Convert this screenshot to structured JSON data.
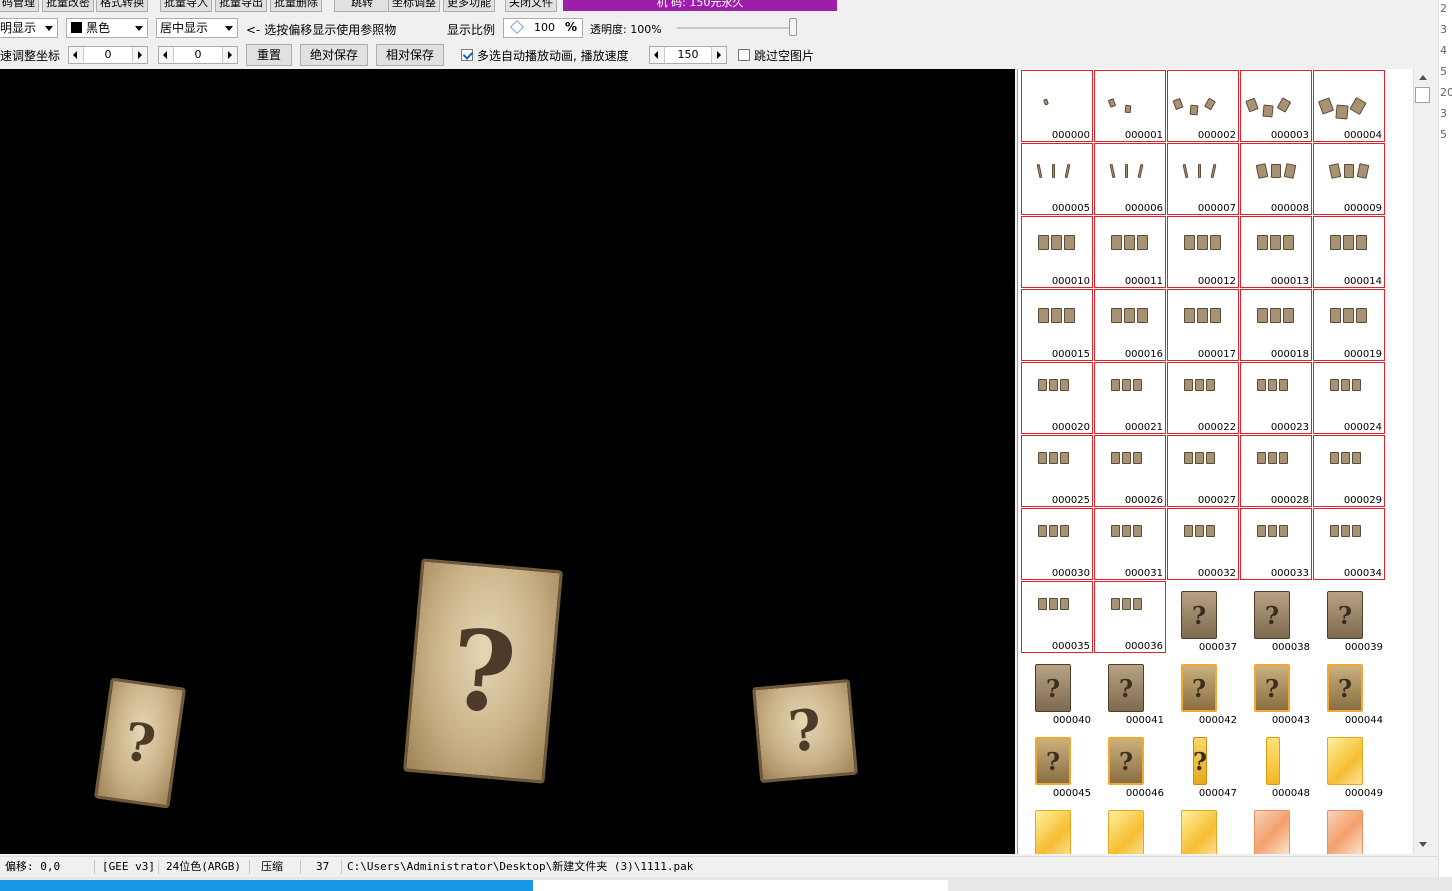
{
  "toolbar_top": {
    "buttons": [
      "码管理",
      "批量改密",
      "格式转换",
      "批量导入",
      "批量导出",
      "批量删除",
      "跳转",
      "坐标调整",
      "更多功能",
      "关闭文件"
    ],
    "banner": "机 码: 150元永久"
  },
  "toolbar1": {
    "display_mode": "明显示",
    "bg_color_label": "黑色",
    "bg_color_swatch": "#000000",
    "align": "居中显示",
    "hint": "<- 选按偏移显示使用参照物",
    "scale_label": "显示比例",
    "scale_value": "100",
    "scale_unit": "%",
    "opacity_label": "透明度: 100%",
    "opacity_value": 100
  },
  "toolbar2": {
    "adjust_label": "速调整坐标",
    "x_value": "0",
    "y_value": "0",
    "reset_button": "重置",
    "abs_save_button": "绝对保存",
    "rel_save_button": "相对保存",
    "autoplay_label": "多选自动播放动画, 播放速度",
    "autoplay_checked": true,
    "speed_value": "150",
    "skip_empty_label": "跳过空图片",
    "skip_empty_checked": false
  },
  "canvas": {
    "background": "#000000",
    "glyph": "?"
  },
  "thumbnails": {
    "items": [
      "000000",
      "000001",
      "000002",
      "000003",
      "000004",
      "000005",
      "000006",
      "000007",
      "000008",
      "000009",
      "000010",
      "000011",
      "000012",
      "000013",
      "000014",
      "000015",
      "000016",
      "000017",
      "000018",
      "000019",
      "000020",
      "000021",
      "000022",
      "000023",
      "000024",
      "000025",
      "000026",
      "000027",
      "000028",
      "000029",
      "000030",
      "000031",
      "000032",
      "000033",
      "000034",
      "000035",
      "000036",
      "000037",
      "000038",
      "000039",
      "000040",
      "000041",
      "000042",
      "000043",
      "000044",
      "000045",
      "000046",
      "000047",
      "000048",
      "000049",
      "",
      "",
      "",
      "",
      ""
    ],
    "selected_count": 37,
    "accent": "#e0202a"
  },
  "status": {
    "offset": "偏移: 0,0",
    "format": "[GEE v3]",
    "color_depth": "24位色(ARGB)",
    "compress": "压缩",
    "index": "37",
    "path": "C:\\Users\\Administrator\\Desktop\\新建文件夹 (3)\\1111.pak"
  },
  "right_edge_numbers": [
    "2",
    "3",
    "4",
    "5",
    "20",
    "3",
    "5"
  ]
}
